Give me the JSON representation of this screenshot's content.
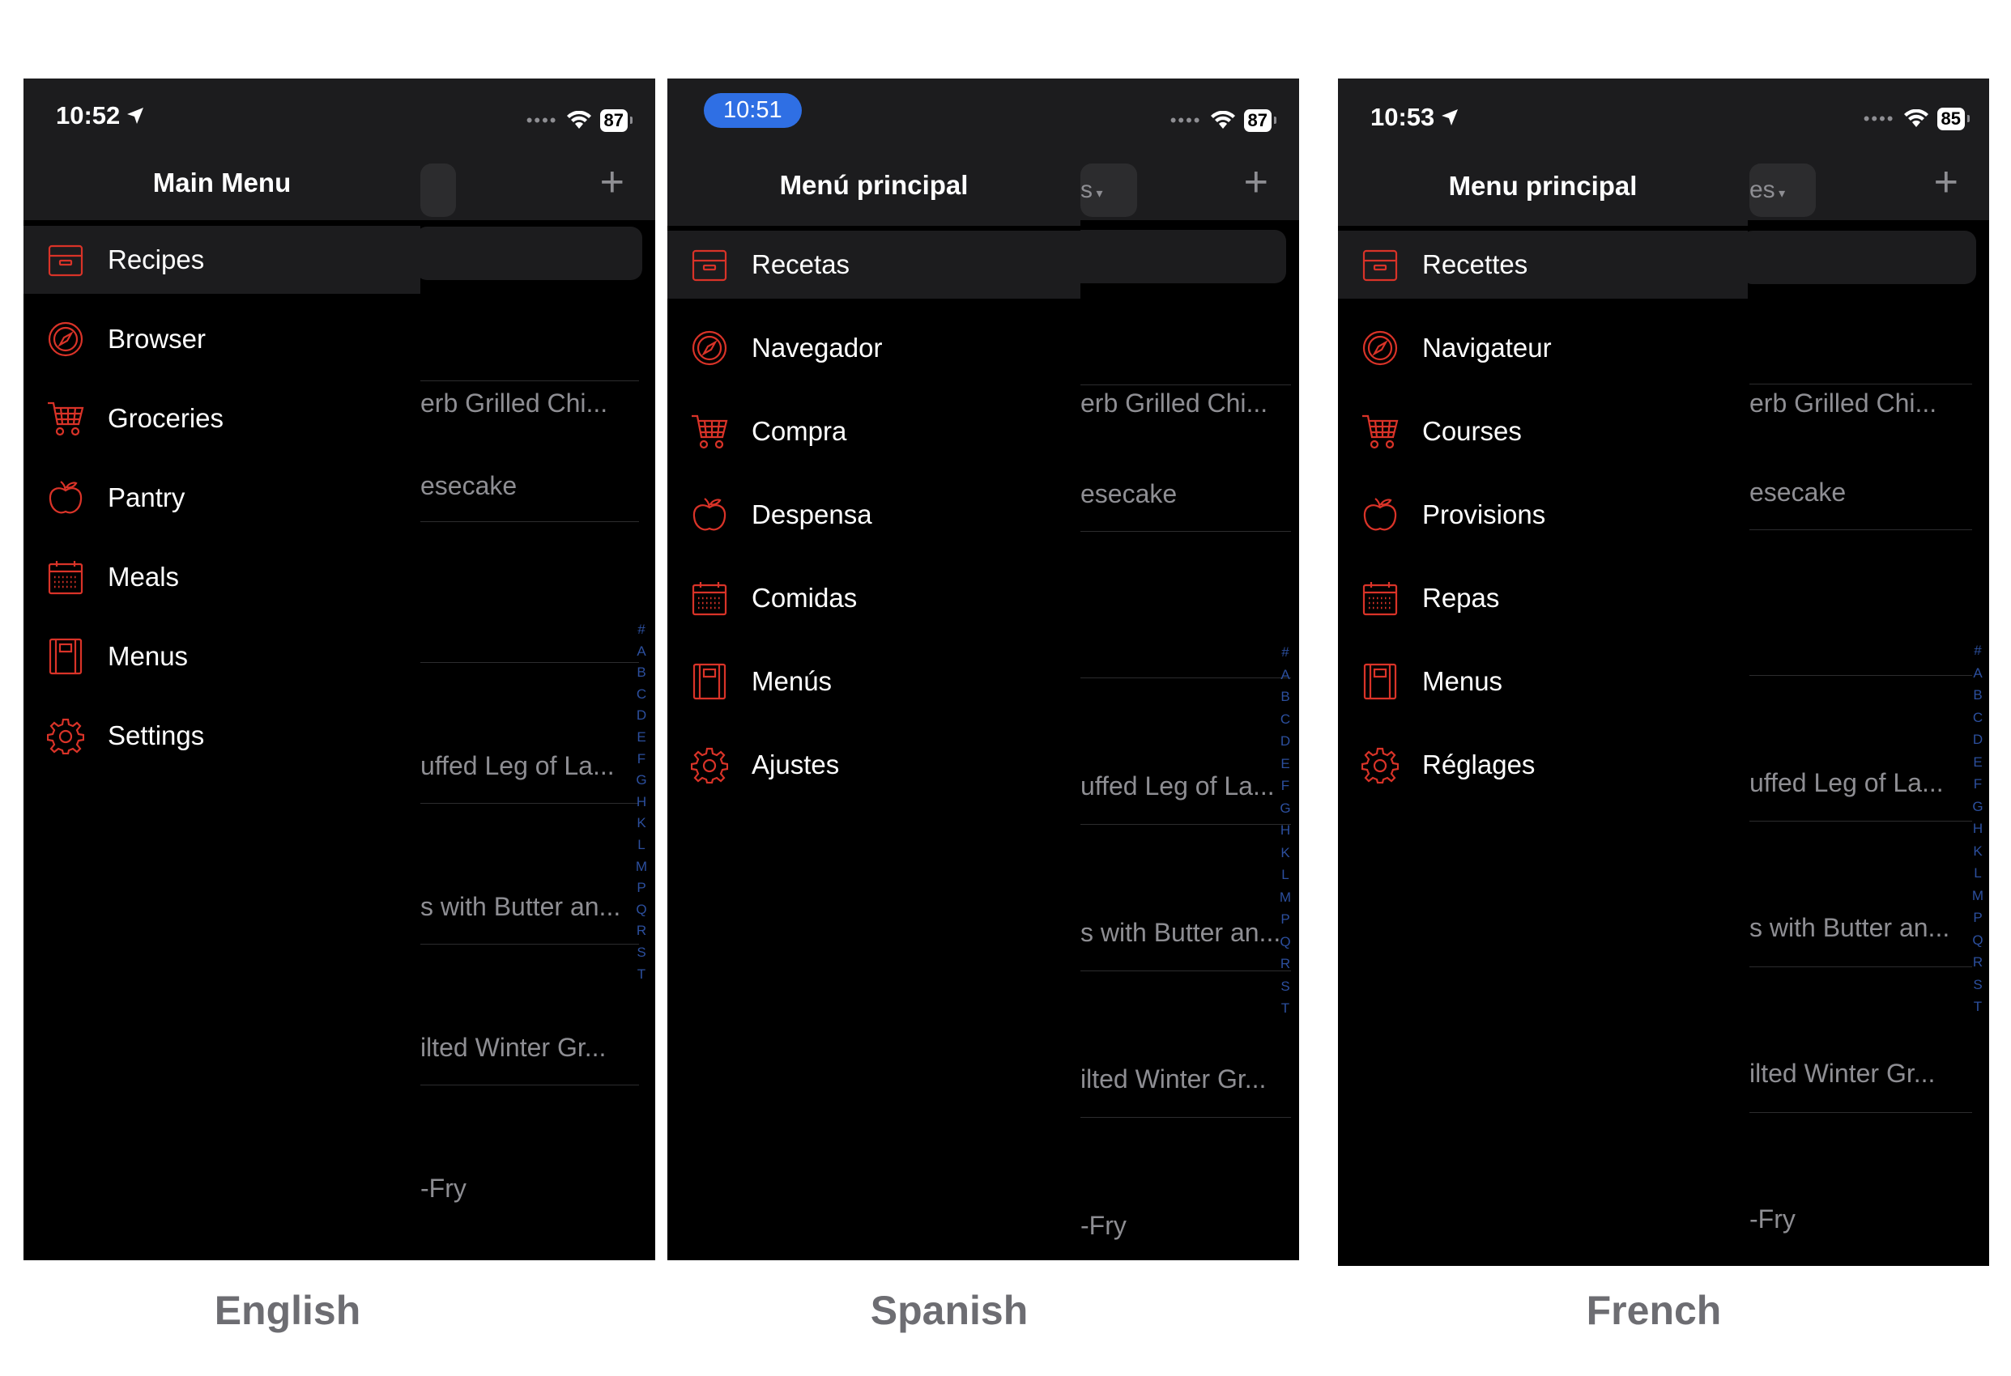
{
  "colors": {
    "accent": "#d93328",
    "alpha_index": "#2c4f9e"
  },
  "screens": [
    {
      "caption": "English",
      "time": "10:52",
      "battery": "87",
      "drawer_title": "Main Menu",
      "search_fragment": "",
      "menu": [
        {
          "label": "Recipes",
          "icon": "recipe-box-icon"
        },
        {
          "label": "Browser",
          "icon": "compass-icon"
        },
        {
          "label": "Groceries",
          "icon": "shopping-cart-icon"
        },
        {
          "label": "Pantry",
          "icon": "apple-icon"
        },
        {
          "label": "Meals",
          "icon": "calendar-icon"
        },
        {
          "label": "Menus",
          "icon": "menu-book-icon"
        },
        {
          "label": "Settings",
          "icon": "gear-icon"
        }
      ],
      "recipes": [
        "erb Grilled Chi...",
        "esecake",
        "",
        "uffed Leg of La...",
        "s with Butter an...",
        "ilted Winter Gr...",
        "-Fry"
      ]
    },
    {
      "caption": "Spanish",
      "time": "10:51",
      "battery": "87",
      "drawer_title": "Menú principal",
      "search_fragment": "s",
      "menu": [
        {
          "label": "Recetas",
          "icon": "recipe-box-icon"
        },
        {
          "label": "Navegador",
          "icon": "compass-icon"
        },
        {
          "label": "Compra",
          "icon": "shopping-cart-icon"
        },
        {
          "label": "Despensa",
          "icon": "apple-icon"
        },
        {
          "label": "Comidas",
          "icon": "calendar-icon"
        },
        {
          "label": "Menús",
          "icon": "menu-book-icon"
        },
        {
          "label": "Ajustes",
          "icon": "gear-icon"
        }
      ],
      "recipes": [
        "erb Grilled Chi...",
        "esecake",
        "",
        "uffed Leg of La...",
        "s with Butter an...",
        "ilted Winter Gr...",
        "-Fry"
      ]
    },
    {
      "caption": "French",
      "time": "10:53",
      "battery": "85",
      "drawer_title": "Menu principal",
      "search_fragment": "es",
      "menu": [
        {
          "label": "Recettes",
          "icon": "recipe-box-icon"
        },
        {
          "label": "Navigateur",
          "icon": "compass-icon"
        },
        {
          "label": "Courses",
          "icon": "shopping-cart-icon"
        },
        {
          "label": "Provisions",
          "icon": "apple-icon"
        },
        {
          "label": "Repas",
          "icon": "calendar-icon"
        },
        {
          "label": "Menus",
          "icon": "menu-book-icon"
        },
        {
          "label": "Réglages",
          "icon": "gear-icon"
        }
      ],
      "recipes": [
        "erb Grilled Chi...",
        "esecake",
        "",
        "uffed Leg of La...",
        "s with Butter an...",
        "ilted Winter Gr...",
        "-Fry"
      ]
    }
  ],
  "alpha_index": [
    "#",
    "A",
    "B",
    "C",
    "D",
    "E",
    "F",
    "G",
    "H",
    "K",
    "L",
    "M",
    "P",
    "Q",
    "R",
    "S",
    "T"
  ]
}
